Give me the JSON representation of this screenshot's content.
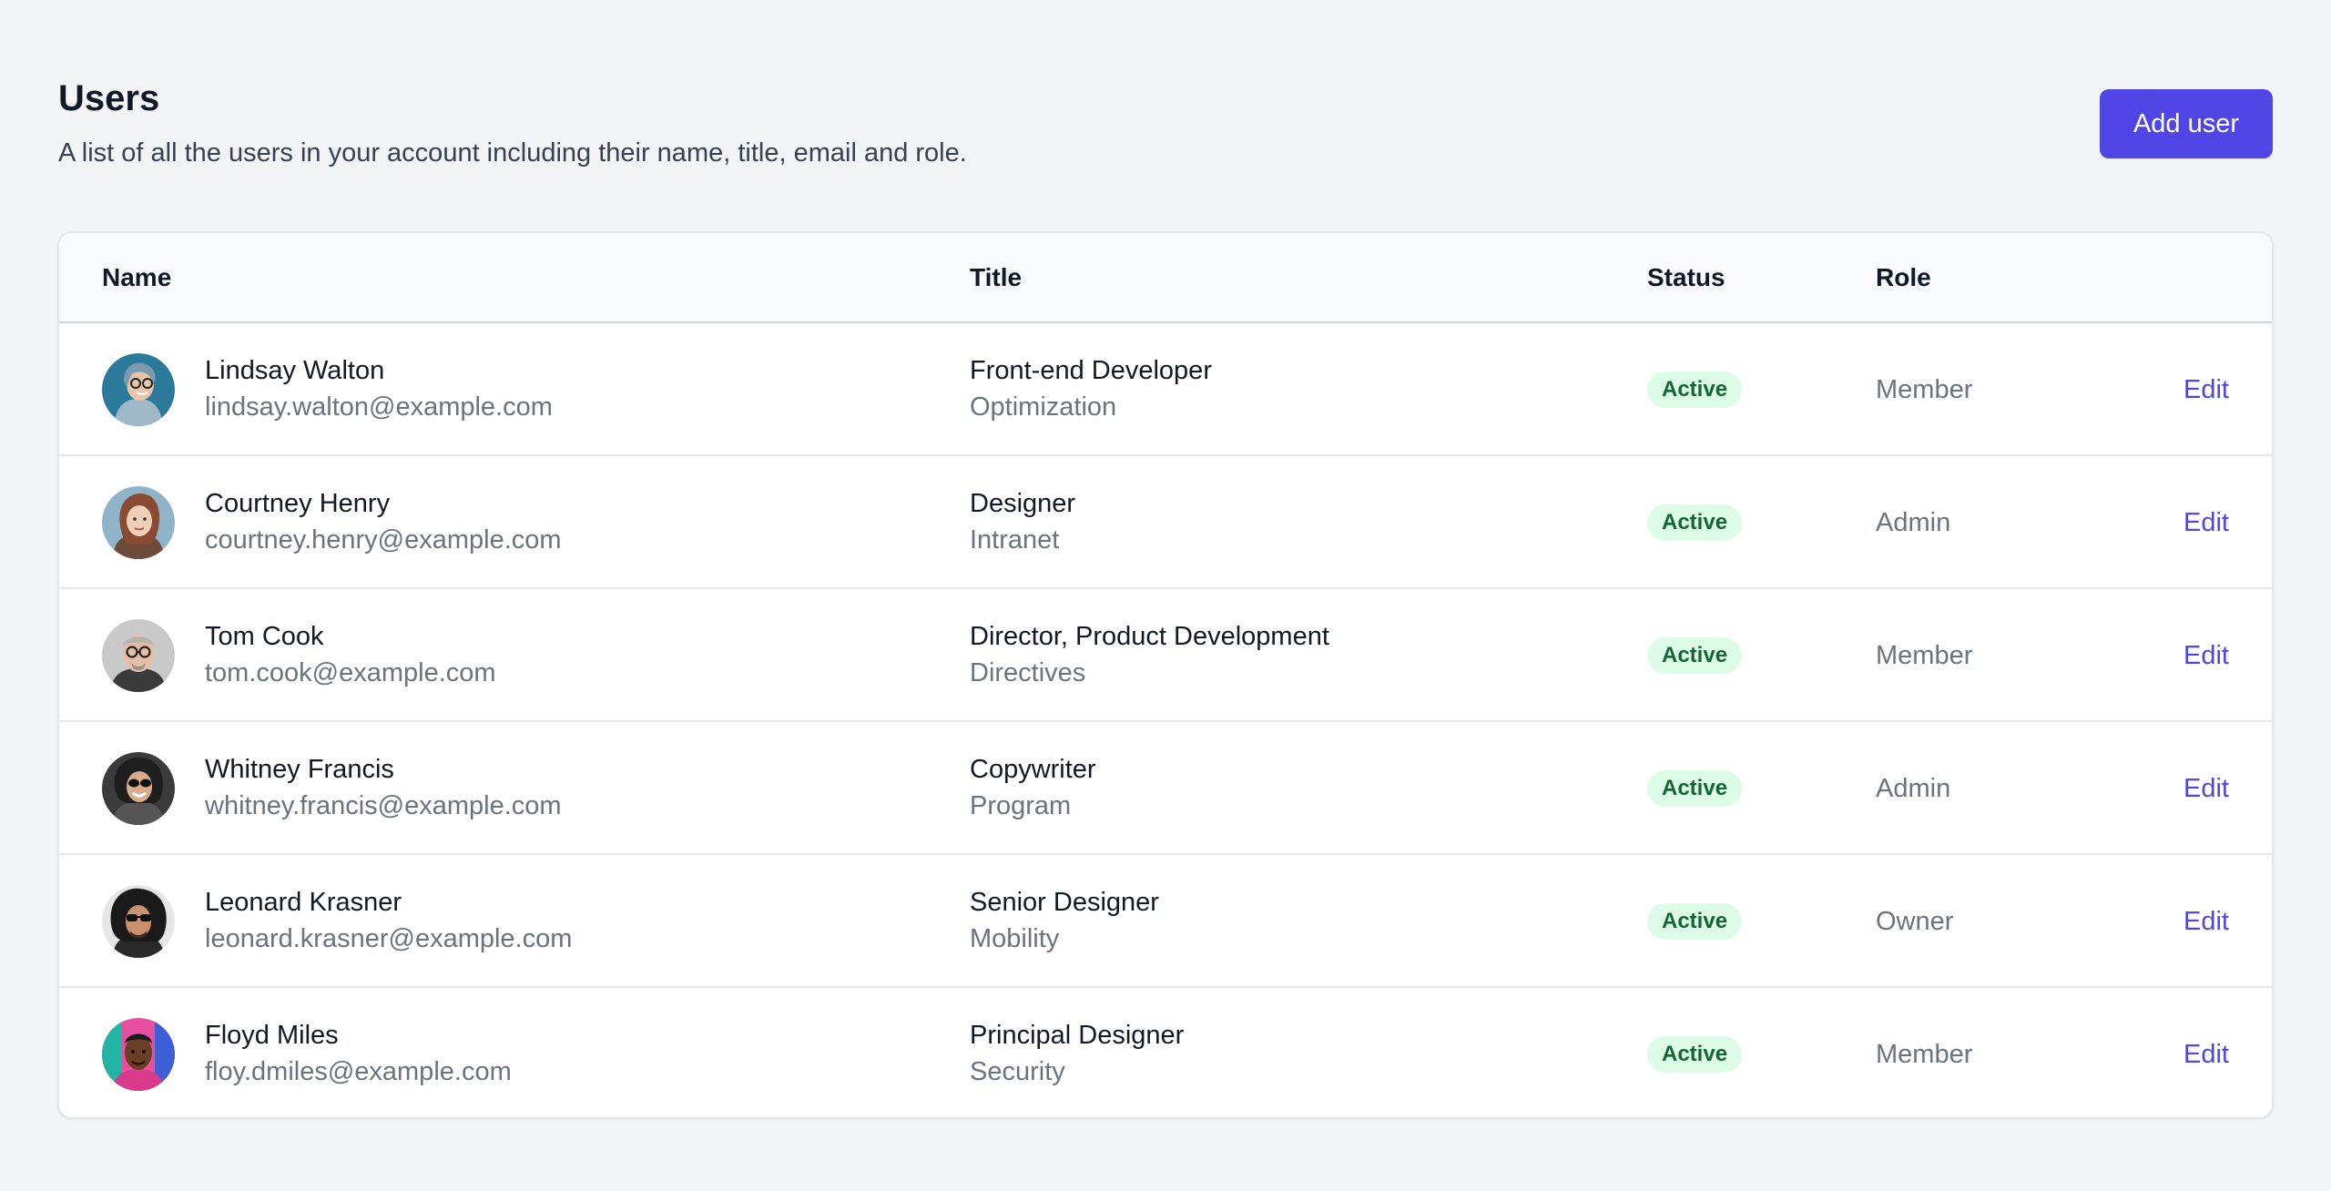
{
  "header": {
    "title": "Users",
    "subtitle": "A list of all the users in your account including their name, title, email and role.",
    "add_button_label": "Add user"
  },
  "table": {
    "columns": {
      "name": "Name",
      "title": "Title",
      "status": "Status",
      "role": "Role"
    },
    "rows": [
      {
        "name": "Lindsay Walton",
        "email": "lindsay.walton@example.com",
        "title": "Front-end Developer",
        "department": "Optimization",
        "status": "Active",
        "role": "Member",
        "action": "Edit"
      },
      {
        "name": "Courtney Henry",
        "email": "courtney.henry@example.com",
        "title": "Designer",
        "department": "Intranet",
        "status": "Active",
        "role": "Admin",
        "action": "Edit"
      },
      {
        "name": "Tom Cook",
        "email": "tom.cook@example.com",
        "title": "Director, Product Development",
        "department": "Directives",
        "status": "Active",
        "role": "Member",
        "action": "Edit"
      },
      {
        "name": "Whitney Francis",
        "email": "whitney.francis@example.com",
        "title": "Copywriter",
        "department": "Program",
        "status": "Active",
        "role": "Admin",
        "action": "Edit"
      },
      {
        "name": "Leonard Krasner",
        "email": "leonard.krasner@example.com",
        "title": "Senior Designer",
        "department": "Mobility",
        "status": "Active",
        "role": "Owner",
        "action": "Edit"
      },
      {
        "name": "Floyd Miles",
        "email": "floy.dmiles@example.com",
        "title": "Principal Designer",
        "department": "Security",
        "status": "Active",
        "role": "Member",
        "action": "Edit"
      }
    ]
  },
  "colors": {
    "accent": "#4f46e5",
    "status_bg": "#dcfce7",
    "status_text": "#166534",
    "page_bg": "#f3f4f6"
  },
  "icons": {
    "avatar": "user-photo-avatar"
  }
}
